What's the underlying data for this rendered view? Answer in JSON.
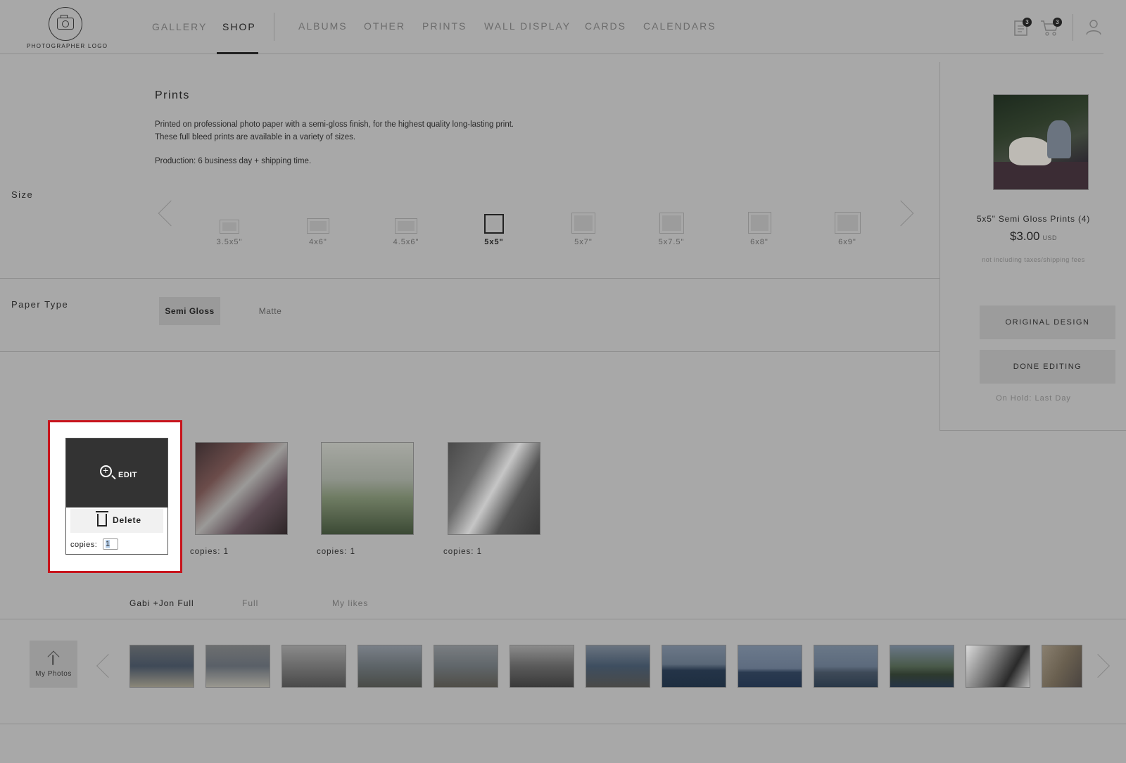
{
  "logo": {
    "text": "PHOTOGRAPHER LOGO"
  },
  "nav": {
    "items": [
      "GALLERY",
      "SHOP",
      "ALBUMS",
      "OTHER",
      "PRINTS",
      "WALL DISPLAY",
      "CARDS",
      "CALENDARS"
    ],
    "active": "SHOP"
  },
  "header": {
    "orders_badge": "3",
    "cart_badge": "3"
  },
  "product": {
    "title": "Prints",
    "desc_line1": "Printed on professional photo paper with a semi-gloss finish, for the highest quality long-lasting print.",
    "desc_line2": "These full bleed prints are available in a variety of sizes.",
    "production": "Production: 6 business day + shipping time."
  },
  "size": {
    "label": "Size",
    "options": [
      "3.5x5\"",
      "4x6\"",
      "4.5x6\"",
      "5x5\"",
      "5x7\"",
      "5x7.5\"",
      "6x8\"",
      "6x9\""
    ],
    "selected": "5x5\""
  },
  "paper": {
    "label": "Paper Type",
    "options": [
      "Semi Gloss",
      "Matte"
    ],
    "selected": "Semi Gloss"
  },
  "summary": {
    "title": "5x5\" Semi Gloss Prints (4)",
    "price": "$3.00",
    "currency": "USD",
    "note": "not including taxes/shipping fees",
    "btn_original": "ORIGINAL DESIGN",
    "btn_done": "DONE EDITING",
    "hold": "On Hold: Last Day"
  },
  "photos": {
    "edit_label": "EDIT",
    "delete_label": "Delete",
    "copies_label": "copies:",
    "copies_value": "1",
    "items": [
      {
        "copies": "copies: 1"
      },
      {
        "copies": "copies: 1"
      },
      {
        "copies": "copies: 1"
      }
    ]
  },
  "albums": {
    "tabs": [
      "Gabi +Jon Full",
      "Full",
      "My likes"
    ],
    "active": "Gabi +Jon Full"
  },
  "filmstrip": {
    "upload_label": "My Photos"
  },
  "colors": {
    "highlight": "#c8141c",
    "overlay": "#a8a8a8"
  }
}
